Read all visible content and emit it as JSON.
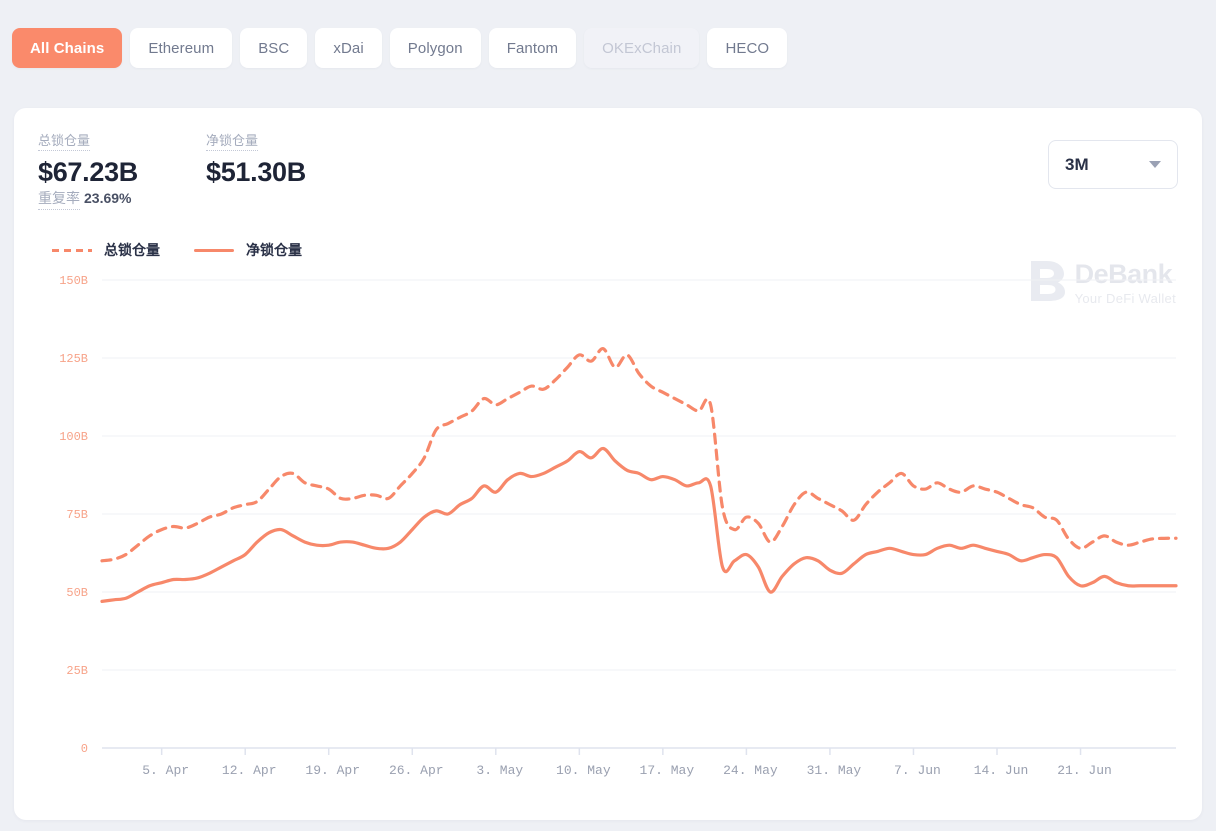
{
  "tabs": [
    {
      "label": "All Chains",
      "state": "active"
    },
    {
      "label": "Ethereum",
      "state": "normal"
    },
    {
      "label": "BSC",
      "state": "normal"
    },
    {
      "label": "xDai",
      "state": "normal"
    },
    {
      "label": "Polygon",
      "state": "normal"
    },
    {
      "label": "Fantom",
      "state": "normal"
    },
    {
      "label": "OKExChain",
      "state": "disabled"
    },
    {
      "label": "HECO",
      "state": "normal"
    }
  ],
  "stats": {
    "total": {
      "label": "总锁仓量",
      "value": "$67.23B"
    },
    "net": {
      "label": "净锁仓量",
      "value": "$51.30B"
    },
    "duplication": {
      "label": "重复率",
      "value": "23.69%"
    }
  },
  "range_select": {
    "value": "3M",
    "icon": "chevron-down-icon"
  },
  "watermark": {
    "logo": "debank-logo-icon",
    "title": "DeBank",
    "subtitle": "Your DeFi Wallet"
  },
  "colors": {
    "accent": "#fa8a6b",
    "line": "#f7886a",
    "axis_label": "#f7a389",
    "grid": "#eff0f4",
    "page_bg": "#eef0f5",
    "card_bg": "#ffffff"
  },
  "chart_data": {
    "type": "line",
    "title": "",
    "xlabel": "",
    "ylabel": "",
    "grid": true,
    "legend_position": "top-left",
    "ylim": [
      0,
      150
    ],
    "ytick_labels": [
      "150B",
      "125B",
      "100B",
      "75B",
      "50B",
      "25B",
      "0"
    ],
    "ytick_values": [
      150,
      125,
      100,
      75,
      50,
      25,
      0
    ],
    "xtick_labels": [
      "5. Apr",
      "12. Apr",
      "19. Apr",
      "26. Apr",
      "3. May",
      "10. May",
      "17. May",
      "24. May",
      "31. May",
      "7. Jun",
      "14. Jun",
      "21. Jun"
    ],
    "xtick_positions": [
      5,
      12,
      19,
      26,
      33,
      40,
      47,
      54,
      61,
      68,
      75,
      82
    ],
    "x_range": [
      0,
      90
    ],
    "series": [
      {
        "name": "总锁仓量",
        "style": "dashed",
        "color": "#f7886a",
        "values": [
          60,
          60.5,
          62,
          65,
          68,
          70,
          71,
          70.5,
          72,
          74,
          75,
          77,
          78,
          79,
          83,
          87,
          88,
          85,
          84,
          83,
          80,
          80,
          81,
          81,
          80,
          84,
          88,
          93,
          102,
          104,
          106,
          108,
          112,
          110,
          112,
          114,
          116,
          115,
          118,
          122,
          126,
          124,
          128,
          122,
          126,
          120,
          116,
          114,
          112,
          110,
          108,
          110,
          77,
          70,
          74,
          72,
          66,
          71,
          78,
          82,
          80,
          78,
          76,
          73,
          78,
          82,
          85,
          88,
          84,
          83,
          85,
          83,
          82,
          84,
          83,
          82,
          80,
          78,
          77,
          74,
          73,
          67,
          64,
          66,
          68,
          66,
          65,
          66,
          67,
          67.2,
          67.23
        ]
      },
      {
        "name": "净锁仓量",
        "style": "solid",
        "color": "#f7886a",
        "values": [
          47,
          47.5,
          48,
          50,
          52,
          53,
          54,
          54,
          54.5,
          56,
          58,
          60,
          62,
          66,
          69,
          70,
          68,
          66,
          65,
          65,
          66,
          66,
          65,
          64,
          64,
          66,
          70,
          74,
          76,
          75,
          78,
          80,
          84,
          82,
          86,
          88,
          87,
          88,
          90,
          92,
          95,
          93,
          96,
          92,
          89,
          88,
          86,
          87,
          86,
          84,
          85,
          84,
          58,
          60,
          62,
          58,
          50,
          55,
          59,
          61,
          60,
          57,
          56,
          59,
          62,
          63,
          64,
          63,
          62,
          62,
          64,
          65,
          64,
          65,
          64,
          63,
          62,
          60,
          61,
          62,
          61,
          55,
          52,
          53,
          55,
          53,
          52,
          52,
          52,
          52,
          52
        ]
      }
    ]
  }
}
